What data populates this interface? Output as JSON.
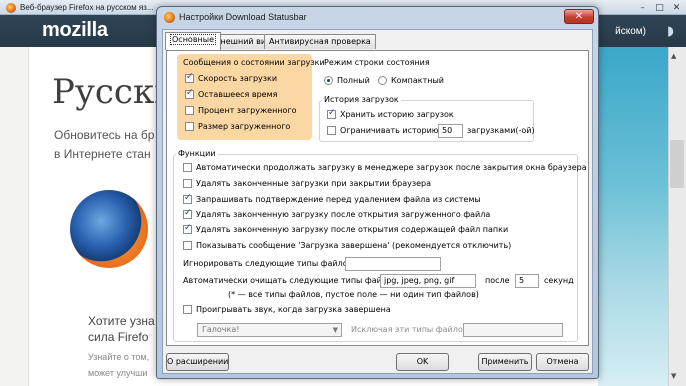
{
  "background": {
    "tab_label": "Веб-браузер Firefox на русском яз...",
    "win_controls": [
      "–",
      "□",
      "✕"
    ],
    "logo": "mozilla",
    "header_right": "йском)",
    "heading": "Русски",
    "intro_line1": "Обновитесь на бр",
    "intro_line2": "в Интернете стан",
    "promo_line1": "Хотите узна",
    "promo_line2": "сила Firefo",
    "small_line1": "Узнайте о том,",
    "small_line2": "может улучши"
  },
  "dialog": {
    "title": "Настройки Download Statusbar",
    "close_glyph": "✕",
    "tabs": [
      {
        "label": "Основные"
      },
      {
        "label": "Внешний вид"
      },
      {
        "label": "Антивирусная проверка"
      }
    ],
    "messages_group": {
      "title": "Сообщения о состоянии загрузки",
      "items": [
        {
          "label": "Скорость загрузки",
          "checked": true
        },
        {
          "label": "Оставшееся время",
          "checked": true
        },
        {
          "label": "Процент загруженного",
          "checked": false
        },
        {
          "label": "Размер загруженного",
          "checked": false
        }
      ]
    },
    "mode_group": {
      "title": "Режим строки состояния",
      "options": [
        {
          "label": "Полный",
          "selected": true
        },
        {
          "label": "Компактный",
          "selected": false
        }
      ]
    },
    "history_group": {
      "title": "История загрузок",
      "keep_history": {
        "label": "Хранить историю загрузок",
        "checked": true
      },
      "limit_history": {
        "label": "Ограничивать историю",
        "checked": false
      },
      "limit_value": "50",
      "limit_unit": "загрузками(-ой)"
    },
    "functions_group": {
      "title": "Функции",
      "items": [
        {
          "label": "Автоматически продолжать загрузку в менеджере загрузок после закрытия окна браузера",
          "checked": false
        },
        {
          "label": "Удалять законченные загрузки при закрытии браузера",
          "checked": false
        },
        {
          "label": "Запрашивать подтверждение перед удалением файла из системы",
          "checked": true
        },
        {
          "label": "Удалять законченную загрузку после открытия загруженного файла",
          "checked": true
        },
        {
          "label": "Удалять законченную загрузку после открытия содержащей файл папки",
          "checked": true
        },
        {
          "label": "Показывать сообщение 'Загрузка завершена' (рекомендуется отключить)",
          "checked": false
        }
      ],
      "ignore_label": "Игнорировать следующие типы файлов:",
      "ignore_value": "",
      "autoclear_label": "Автоматически очищать следующие типы файлов",
      "autoclear_value": "jpg, jpeg, png, gif",
      "after_label": "после",
      "after_value": "5",
      "seconds_label": "секунд",
      "hint": "(* — все типы файлов, пустое поле — ни один тип файлов)",
      "sound": {
        "label": "Проигрывать звук, когда загрузка завершена",
        "checked": false
      },
      "sound_select": "Галочка!",
      "exclude_label": "Исключая эти типы файлов:",
      "exclude_value": ""
    },
    "buttons": {
      "about": "О расширении",
      "ok": "OK",
      "apply": "Применить",
      "cancel": "Отмена"
    }
  }
}
